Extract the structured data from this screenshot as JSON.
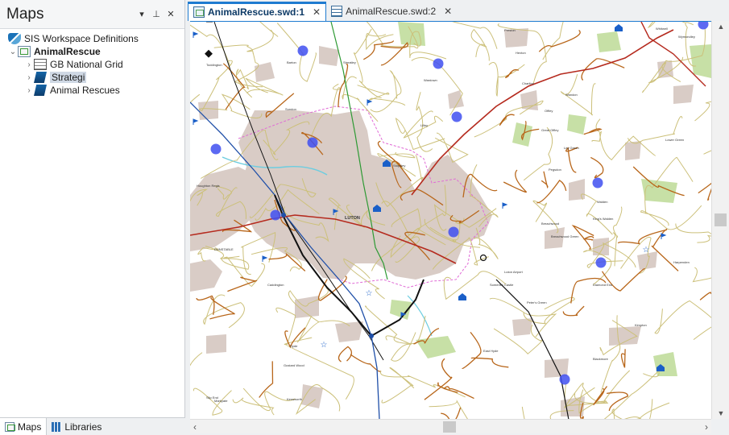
{
  "maps_pane": {
    "title": "Maps",
    "controls": {
      "dropdown": "▾",
      "pin": "⊥",
      "close": "✕"
    },
    "tree": {
      "root": {
        "label": "SIS Workspace Definitions",
        "icon": "workspace-icon"
      },
      "workspace": {
        "label": "AnimalRescue",
        "chevron": "⌄",
        "icon": "map-workspace-icon"
      },
      "children": [
        {
          "label": "GB National Grid",
          "icon": "grid-icon",
          "chevron": "›"
        },
        {
          "label": "Strategi",
          "icon": "layer-icon",
          "chevron": "›",
          "selected": true
        },
        {
          "label": "Animal Rescues",
          "icon": "layer-icon",
          "chevron": "›"
        }
      ]
    },
    "footer_tabs": [
      {
        "label": "Maps",
        "icon": "maps-tab-icon",
        "active": true
      },
      {
        "label": "Libraries",
        "icon": "libraries-icon",
        "active": false
      }
    ]
  },
  "doc_tabs": [
    {
      "label": "AnimalRescue.swd:1",
      "icon": "map-document-icon",
      "active": true,
      "close": "✕"
    },
    {
      "label": "AnimalRescue.swd:2",
      "icon": "table-document-icon",
      "active": false,
      "close": "✕"
    }
  ],
  "map": {
    "town_labels": [
      "LUTON",
      "DUNSTABLE",
      "Caddington",
      "Wardown",
      "Stopsley",
      "Lilley",
      "Offley",
      "Breachwood",
      "Walden",
      "Kimpton",
      "Blackmore",
      "Harpenden",
      "Toddington",
      "Houghton Regis",
      "Streatley",
      "Sundon",
      "Barton",
      "Hexton",
      "Pegsdon",
      "Lower Green",
      "Whitwell",
      "Preston",
      "Gustard Wood",
      "Slip End",
      "Markyate",
      "Kensworth",
      "Hyde",
      "Peter's Green",
      "East Hyde",
      "Someries Castle",
      "Luton Airport",
      "Diamond End",
      "Wandon",
      "Charlton",
      "Great Offley",
      "Breachwood Green",
      "Ley Green",
      "King's Walden",
      "Wymondley"
    ],
    "colors": {
      "urban": "#d9ccc6",
      "major_road": "#b52a1e",
      "a_road": "#b8661a",
      "b_road": "#ccc07a",
      "motorway": "#1f4fa8",
      "rail": "#111111",
      "boundary": "#e06ad6",
      "woodland": "#c7e0a6",
      "water": "#6ccde0",
      "rescue_marker": "#3f4ff0",
      "green_route": "#2e9a34"
    }
  },
  "scrollbars": {
    "up": "▲",
    "down": "▼",
    "left": "‹",
    "right": "›"
  }
}
